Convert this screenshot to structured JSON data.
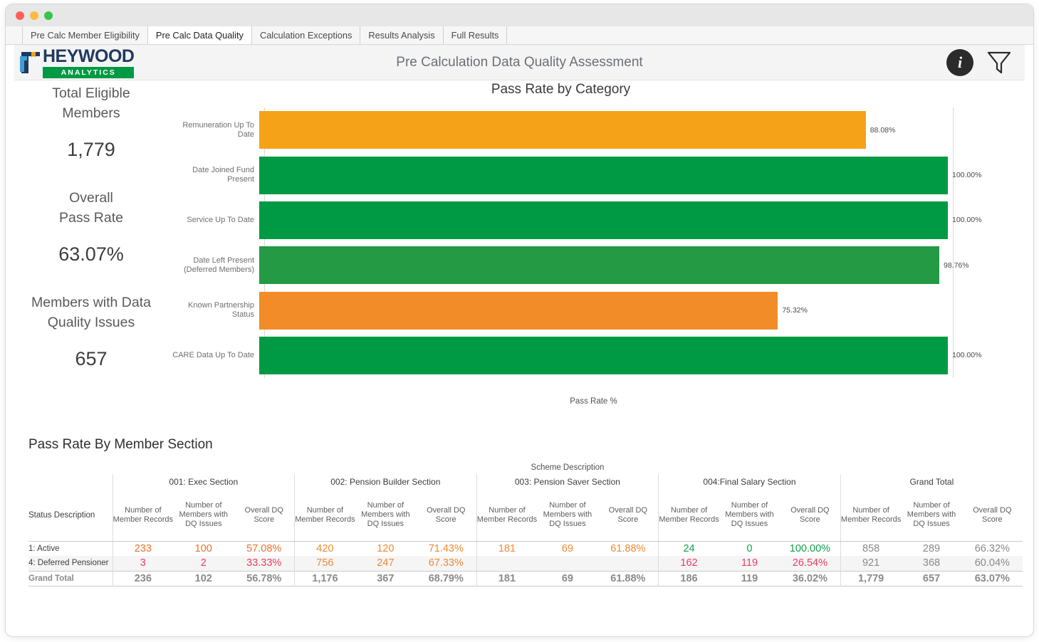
{
  "window": {
    "traffic_lights": [
      "close",
      "minimize",
      "maximize"
    ]
  },
  "tabs": [
    {
      "label": "Pre Calc Member Eligibility",
      "active": false
    },
    {
      "label": "Pre Calc Data Quality",
      "active": true
    },
    {
      "label": "Calculation Exceptions",
      "active": false
    },
    {
      "label": "Results Analysis",
      "active": false
    },
    {
      "label": "Full Results",
      "active": false
    }
  ],
  "header": {
    "title": "Pre Calculation Data Quality Assessment",
    "logo_word": "HEYWOOD",
    "logo_band": "ANALYTICS",
    "info_icon": "info-icon",
    "filter_icon": "filter-funnel-icon",
    "brand_navy": "#1f3a5f",
    "brand_green": "#009a44"
  },
  "kpis": [
    {
      "label_line1": "Total Eligible",
      "label_line2": "Members",
      "value": "1,779"
    },
    {
      "label_line1": "Overall",
      "label_line2": "Pass Rate",
      "value": "63.07%"
    },
    {
      "label_line1": "Members with Data",
      "label_line2": "Quality Issues",
      "value": "657"
    }
  ],
  "chart_data": {
    "type": "bar",
    "orientation": "horizontal",
    "title": "Pass Rate by Category",
    "xlabel": "Pass Rate %",
    "ylabel": "",
    "xlim": [
      0,
      100
    ],
    "grid": true,
    "categories": [
      "Remuneration Up To Date",
      "Date Joined Fund Present",
      "Service Up To Date",
      "Date Left Present (Deferred Members)",
      "Known Partnership Status",
      "CARE Data Up To Date"
    ],
    "values": [
      88.08,
      100.0,
      100.0,
      98.76,
      75.32,
      100.0
    ],
    "labels": [
      "88.08%",
      "100.00%",
      "100.00%",
      "98.76%",
      "75.32%",
      "100.00%"
    ],
    "colors": [
      "#f5a219",
      "#009a44",
      "#009a44",
      "#249a45",
      "#f28c28",
      "#009a44"
    ]
  },
  "table": {
    "title": "Pass Rate By Member Section",
    "scheme_header": "Scheme Description",
    "status_header": "Status Description",
    "groups": [
      "001: Exec Section",
      "002: Pension Builder Section",
      "003: Pension Saver Section",
      "004:Final Salary Section",
      "Grand Total"
    ],
    "subheaders": [
      "Number of Member Records",
      "Number of Members with DQ Issues",
      "Overall DQ Score"
    ],
    "rows": [
      {
        "label": "1: Active",
        "striped": false,
        "cells": [
          {
            "v": "233",
            "c": "c-orange"
          },
          {
            "v": "100",
            "c": "c-orange"
          },
          {
            "v": "57.08%",
            "c": "c-orange"
          },
          {
            "v": "420",
            "c": "c-orange2"
          },
          {
            "v": "120",
            "c": "c-orange2"
          },
          {
            "v": "71.43%",
            "c": "c-orange2"
          },
          {
            "v": "181",
            "c": "c-orange2"
          },
          {
            "v": "69",
            "c": "c-orange2"
          },
          {
            "v": "61.88%",
            "c": "c-orange2"
          },
          {
            "v": "24",
            "c": "c-green"
          },
          {
            "v": "0",
            "c": "c-green"
          },
          {
            "v": "100.00%",
            "c": "c-green"
          },
          {
            "v": "858",
            "c": "c-grey"
          },
          {
            "v": "289",
            "c": "c-grey"
          },
          {
            "v": "66.32%",
            "c": "c-grey"
          }
        ]
      },
      {
        "label": "4: Deferred Pensioner",
        "striped": true,
        "cells": [
          {
            "v": "3",
            "c": "c-red"
          },
          {
            "v": "2",
            "c": "c-red"
          },
          {
            "v": "33.33%",
            "c": "c-red"
          },
          {
            "v": "756",
            "c": "c-orange2"
          },
          {
            "v": "247",
            "c": "c-orange2"
          },
          {
            "v": "67.33%",
            "c": "c-orange2"
          },
          {
            "v": "",
            "c": ""
          },
          {
            "v": "",
            "c": ""
          },
          {
            "v": "",
            "c": ""
          },
          {
            "v": "162",
            "c": "c-red"
          },
          {
            "v": "119",
            "c": "c-red"
          },
          {
            "v": "26.54%",
            "c": "c-red"
          },
          {
            "v": "921",
            "c": "c-grey"
          },
          {
            "v": "368",
            "c": "c-grey"
          },
          {
            "v": "60.04%",
            "c": "c-grey"
          }
        ]
      },
      {
        "label": "Grand Total",
        "striped": false,
        "total": true,
        "cells": [
          {
            "v": "236",
            "c": ""
          },
          {
            "v": "102",
            "c": ""
          },
          {
            "v": "56.78%",
            "c": ""
          },
          {
            "v": "1,176",
            "c": ""
          },
          {
            "v": "367",
            "c": ""
          },
          {
            "v": "68.79%",
            "c": ""
          },
          {
            "v": "181",
            "c": ""
          },
          {
            "v": "69",
            "c": ""
          },
          {
            "v": "61.88%",
            "c": ""
          },
          {
            "v": "186",
            "c": ""
          },
          {
            "v": "119",
            "c": ""
          },
          {
            "v": "36.02%",
            "c": ""
          },
          {
            "v": "1,779",
            "c": ""
          },
          {
            "v": "657",
            "c": ""
          },
          {
            "v": "63.07%",
            "c": ""
          }
        ]
      }
    ]
  }
}
